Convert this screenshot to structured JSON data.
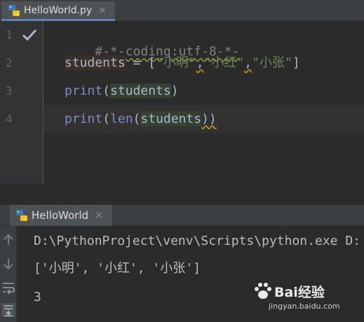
{
  "editor_tab": {
    "filename": "HelloWorld.py",
    "close": "×"
  },
  "gutter": {
    "lines": [
      "1",
      "2",
      "3",
      "4"
    ]
  },
  "code": {
    "line1": "#-*-coding:utf-8-*-",
    "line2_var": "students",
    "line2_eq": " = [",
    "line2_s1": "\"小明\"",
    "line2_c1": ",",
    "line2_s2": "\"小红\"",
    "line2_c2": ",",
    "line2_s3": "\"小张\"",
    "line2_end": "]",
    "line3_fn": "print",
    "line3_open": "(",
    "line3_arg": "students",
    "line3_close": ")",
    "line4_fn": "print",
    "line4_open": "(",
    "line4_fn2": "len",
    "line4_open2": "(",
    "line4_arg": "students",
    "line4_close": "))"
  },
  "run_tab": {
    "label": "HelloWorld",
    "close": "×"
  },
  "console": {
    "line1": "D:\\PythonProject\\venv\\Scripts\\python.exe D:",
    "line2": "['小明', '小红', '小张']",
    "line3": "3"
  },
  "watermark": {
    "logo": "Bai经验",
    "url": "jingyan.baidu.com"
  },
  "colors": {
    "accent": "#4a88c7",
    "keyword": "#8888c6",
    "string": "#6a8759",
    "text": "#a9b7c6",
    "background": "#2b2b2b"
  }
}
